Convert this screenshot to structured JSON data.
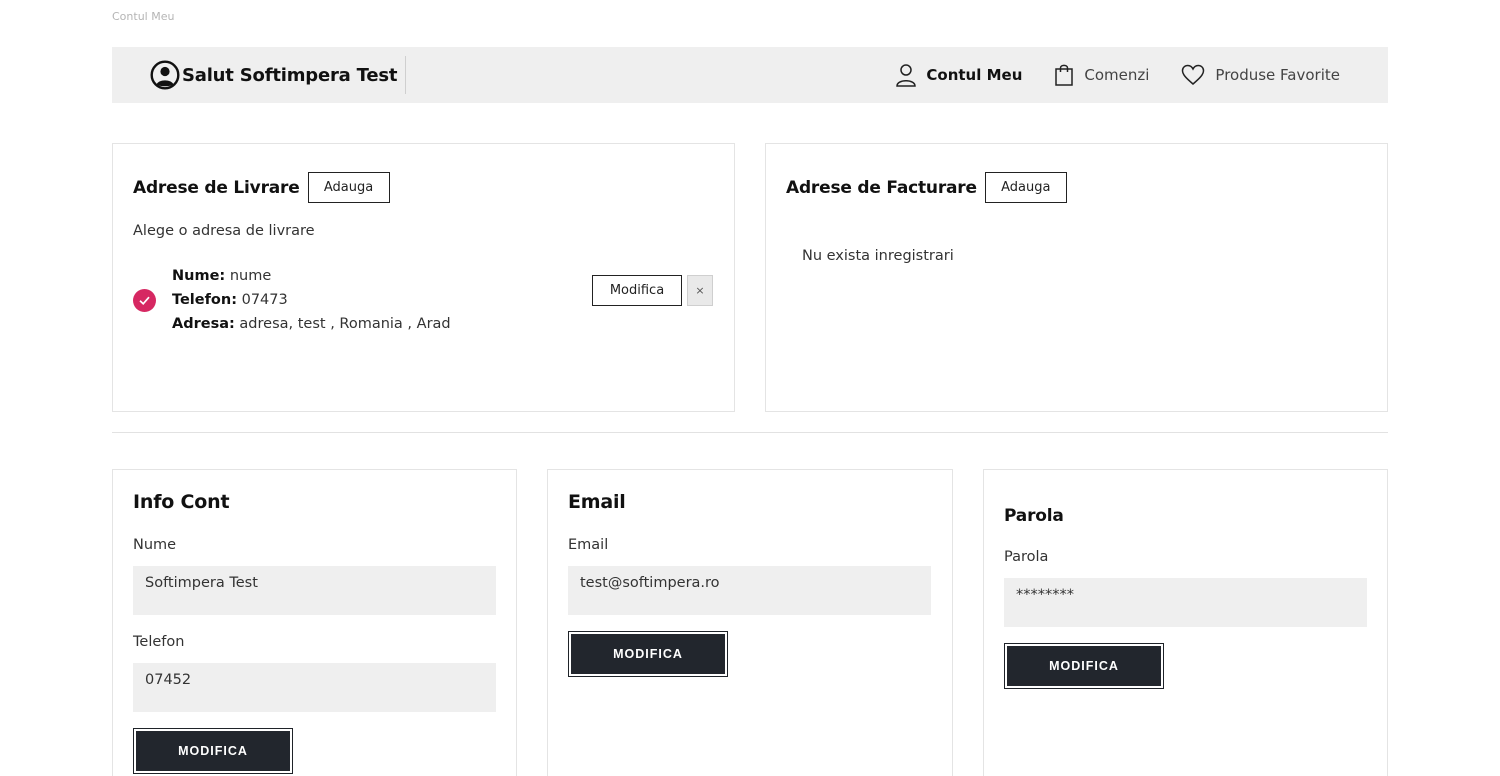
{
  "breadcrumb": "Contul Meu",
  "header": {
    "greeting": "Salut Softimpera Test",
    "nav": [
      {
        "label": "Contul Meu",
        "icon": "user-icon",
        "active": true
      },
      {
        "label": "Comenzi",
        "icon": "shopping-bag-icon",
        "active": false
      },
      {
        "label": "Produse Favorite",
        "icon": "heart-icon",
        "active": false
      }
    ]
  },
  "shipping": {
    "title": "Adrese de Livrare",
    "add_label": "Adauga",
    "hint": "Alege o adresa de livrare",
    "address": {
      "name_label": "Nume:",
      "name": "nume",
      "phone_label": "Telefon:",
      "phone": "07473",
      "address_label": "Adresa:",
      "address": "adresa, test , Romania , Arad"
    },
    "edit_label": "Modifica",
    "remove_label": "×"
  },
  "billing": {
    "title": "Adrese de Facturare",
    "add_label": "Adauga",
    "empty_text": "Nu exista inregistrari"
  },
  "info": {
    "title": "Info Cont",
    "name_label": "Nume",
    "name_value": "Softimpera Test",
    "phone_label": "Telefon",
    "phone_value": "07452",
    "button_label": "MODIFICA"
  },
  "email": {
    "title": "Email",
    "email_label": "Email",
    "email_value": "test@softimpera.ro",
    "button_label": "MODIFICA"
  },
  "password": {
    "title": "Parola",
    "password_label": "Parola",
    "password_value": "********",
    "button_label": "MODIFICA"
  },
  "colors": {
    "accent": "#d62862",
    "button_dark": "#22262d",
    "header_bg": "#efefef"
  }
}
